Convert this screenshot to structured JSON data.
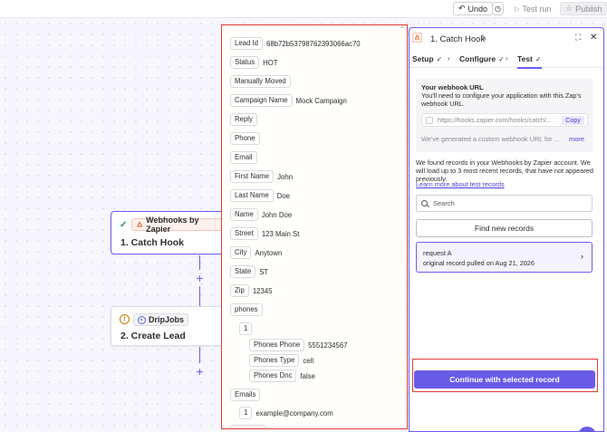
{
  "toolbar": {
    "undo_label": "Undo",
    "test_run_label": "Test run",
    "publish_label": "Publish"
  },
  "steps": [
    {
      "app": "Webhooks by Zapier",
      "title": "1. Catch Hook",
      "status": "complete"
    },
    {
      "app": "DripJobs",
      "title": "2. Create Lead",
      "status": "warning"
    }
  ],
  "record": {
    "fields": [
      {
        "key": "Lead Id",
        "value": "68b72b53798762393066ac70"
      },
      {
        "key": "Status",
        "value": "HOT"
      },
      {
        "key": "Manually Moved",
        "value": ""
      },
      {
        "key": "Campaign Name",
        "value": "Mock Campaign"
      },
      {
        "key": "Reply",
        "value": ""
      },
      {
        "key": "Phone",
        "value": ""
      },
      {
        "key": "Email",
        "value": ""
      },
      {
        "key": "First Name",
        "value": "John"
      },
      {
        "key": "Last Name",
        "value": "Doe"
      },
      {
        "key": "Name",
        "value": "John Doe"
      },
      {
        "key": "Street",
        "value": "123 Main St"
      },
      {
        "key": "City",
        "value": "Anytown"
      },
      {
        "key": "State",
        "value": "ST"
      },
      {
        "key": "Zip",
        "value": "12345"
      },
      {
        "key": "phones",
        "value": ""
      },
      {
        "key": "1",
        "value": ""
      },
      {
        "key": "Phones Phone",
        "value": "5551234567"
      },
      {
        "key": "Phones Type",
        "value": "cell"
      },
      {
        "key": "Phones Dnc",
        "value": "false"
      },
      {
        "key": "Emails",
        "value": ""
      },
      {
        "key": "1",
        "value": "example@company.com"
      }
    ]
  },
  "panel": {
    "title": "1. Catch Hook",
    "tabs": [
      {
        "label": "Setup",
        "check": "✓"
      },
      {
        "label": "Configure",
        "check": "✓"
      },
      {
        "label": "Test",
        "check": "✓"
      }
    ],
    "webhook": {
      "title": "Your webhook URL",
      "description": "You'll need to configure your application with this Zap's webhook URL.",
      "url": "https://hooks.zapier.com/hooks/catch/...",
      "copy_label": "Copy",
      "generated_text": "We've generated a custom webhook URL for ...",
      "more_label": "more"
    },
    "found_text": "We found records in your Webhooks by Zapier account. We will load up to 3 most recent records, that have not appeared previously.",
    "learn_link": "Learn more about test records",
    "search_placeholder": "Search",
    "find_button": "Find new records",
    "records": [
      {
        "title": "request A",
        "subtitle": "original record pulled on Aug 21, 2026"
      }
    ],
    "continue_button": "Continue with selected record"
  },
  "colors": {
    "accent": "#695be8",
    "highlight_border": "#e53935",
    "complete": "#2e8b57",
    "warning": "#c97b00"
  }
}
